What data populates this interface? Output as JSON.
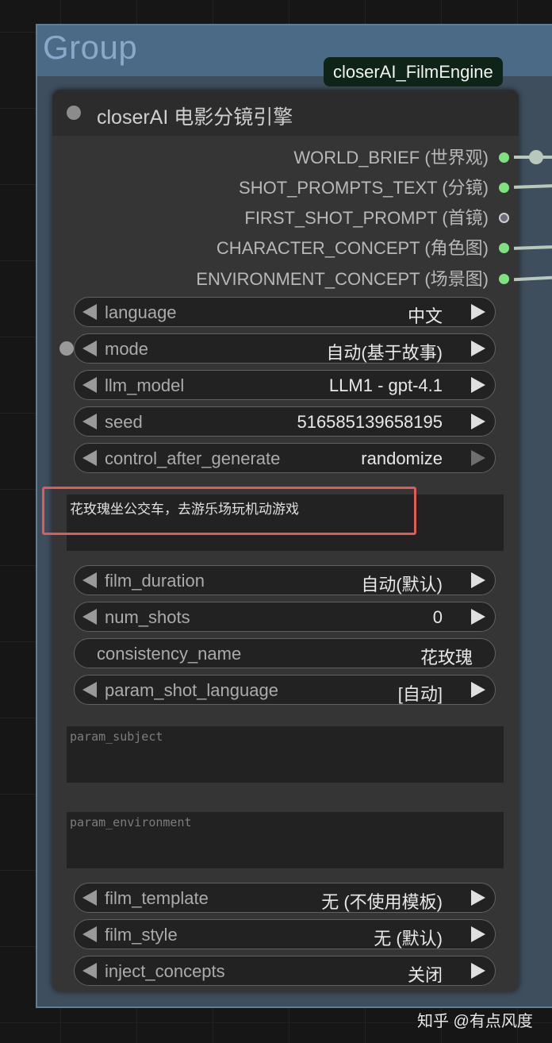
{
  "group": {
    "title": "Group"
  },
  "badge": {
    "label": "closerAI_FilmEngine"
  },
  "node": {
    "title": "closerAI 电影分镜引擎",
    "outputs": [
      {
        "label": "WORLD_BRIEF (世界观)",
        "connected": true
      },
      {
        "label": "SHOT_PROMPTS_TEXT (分镜)",
        "connected": true
      },
      {
        "label": "FIRST_SHOT_PROMPT (首镜)",
        "connected": false
      },
      {
        "label": "CHARACTER_CONCEPT (角色图)",
        "connected": true
      },
      {
        "label": "ENVIRONMENT_CONCEPT (场景图)",
        "connected": true
      }
    ],
    "widgets": {
      "language": {
        "label": "language",
        "value": "中文"
      },
      "mode": {
        "label": "mode",
        "value": "自动(基于故事)"
      },
      "llm_model": {
        "label": "llm_model",
        "value": "LLM1 - gpt-4.1"
      },
      "seed": {
        "label": "seed",
        "value": "516585139658195"
      },
      "control_after_generate": {
        "label": "control_after_generate",
        "value": "randomize"
      },
      "story_text": "花玫瑰坐公交车，去游乐场玩机动游戏",
      "film_duration": {
        "label": "film_duration",
        "value": "自动(默认)"
      },
      "num_shots": {
        "label": "num_shots",
        "value": "0"
      },
      "consistency_name": {
        "label": "consistency_name",
        "value": "花玫瑰"
      },
      "param_shot_language": {
        "label": "param_shot_language",
        "value": "[自动]"
      },
      "param_subject_placeholder": "param_subject",
      "param_environment_placeholder": "param_environment",
      "film_template": {
        "label": "film_template",
        "value": "无 (不使用模板)"
      },
      "film_style": {
        "label": "film_style",
        "value": "无 (默认)"
      },
      "inject_concepts": {
        "label": "inject_concepts",
        "value": "关闭"
      }
    }
  },
  "watermark": "知乎 @有点风度",
  "colors": {
    "connected_socket": "#7ee37e",
    "disconnected_socket": "#6b6b7a",
    "highlight": "#e05a5a",
    "badge_bg": "#0f2418"
  }
}
